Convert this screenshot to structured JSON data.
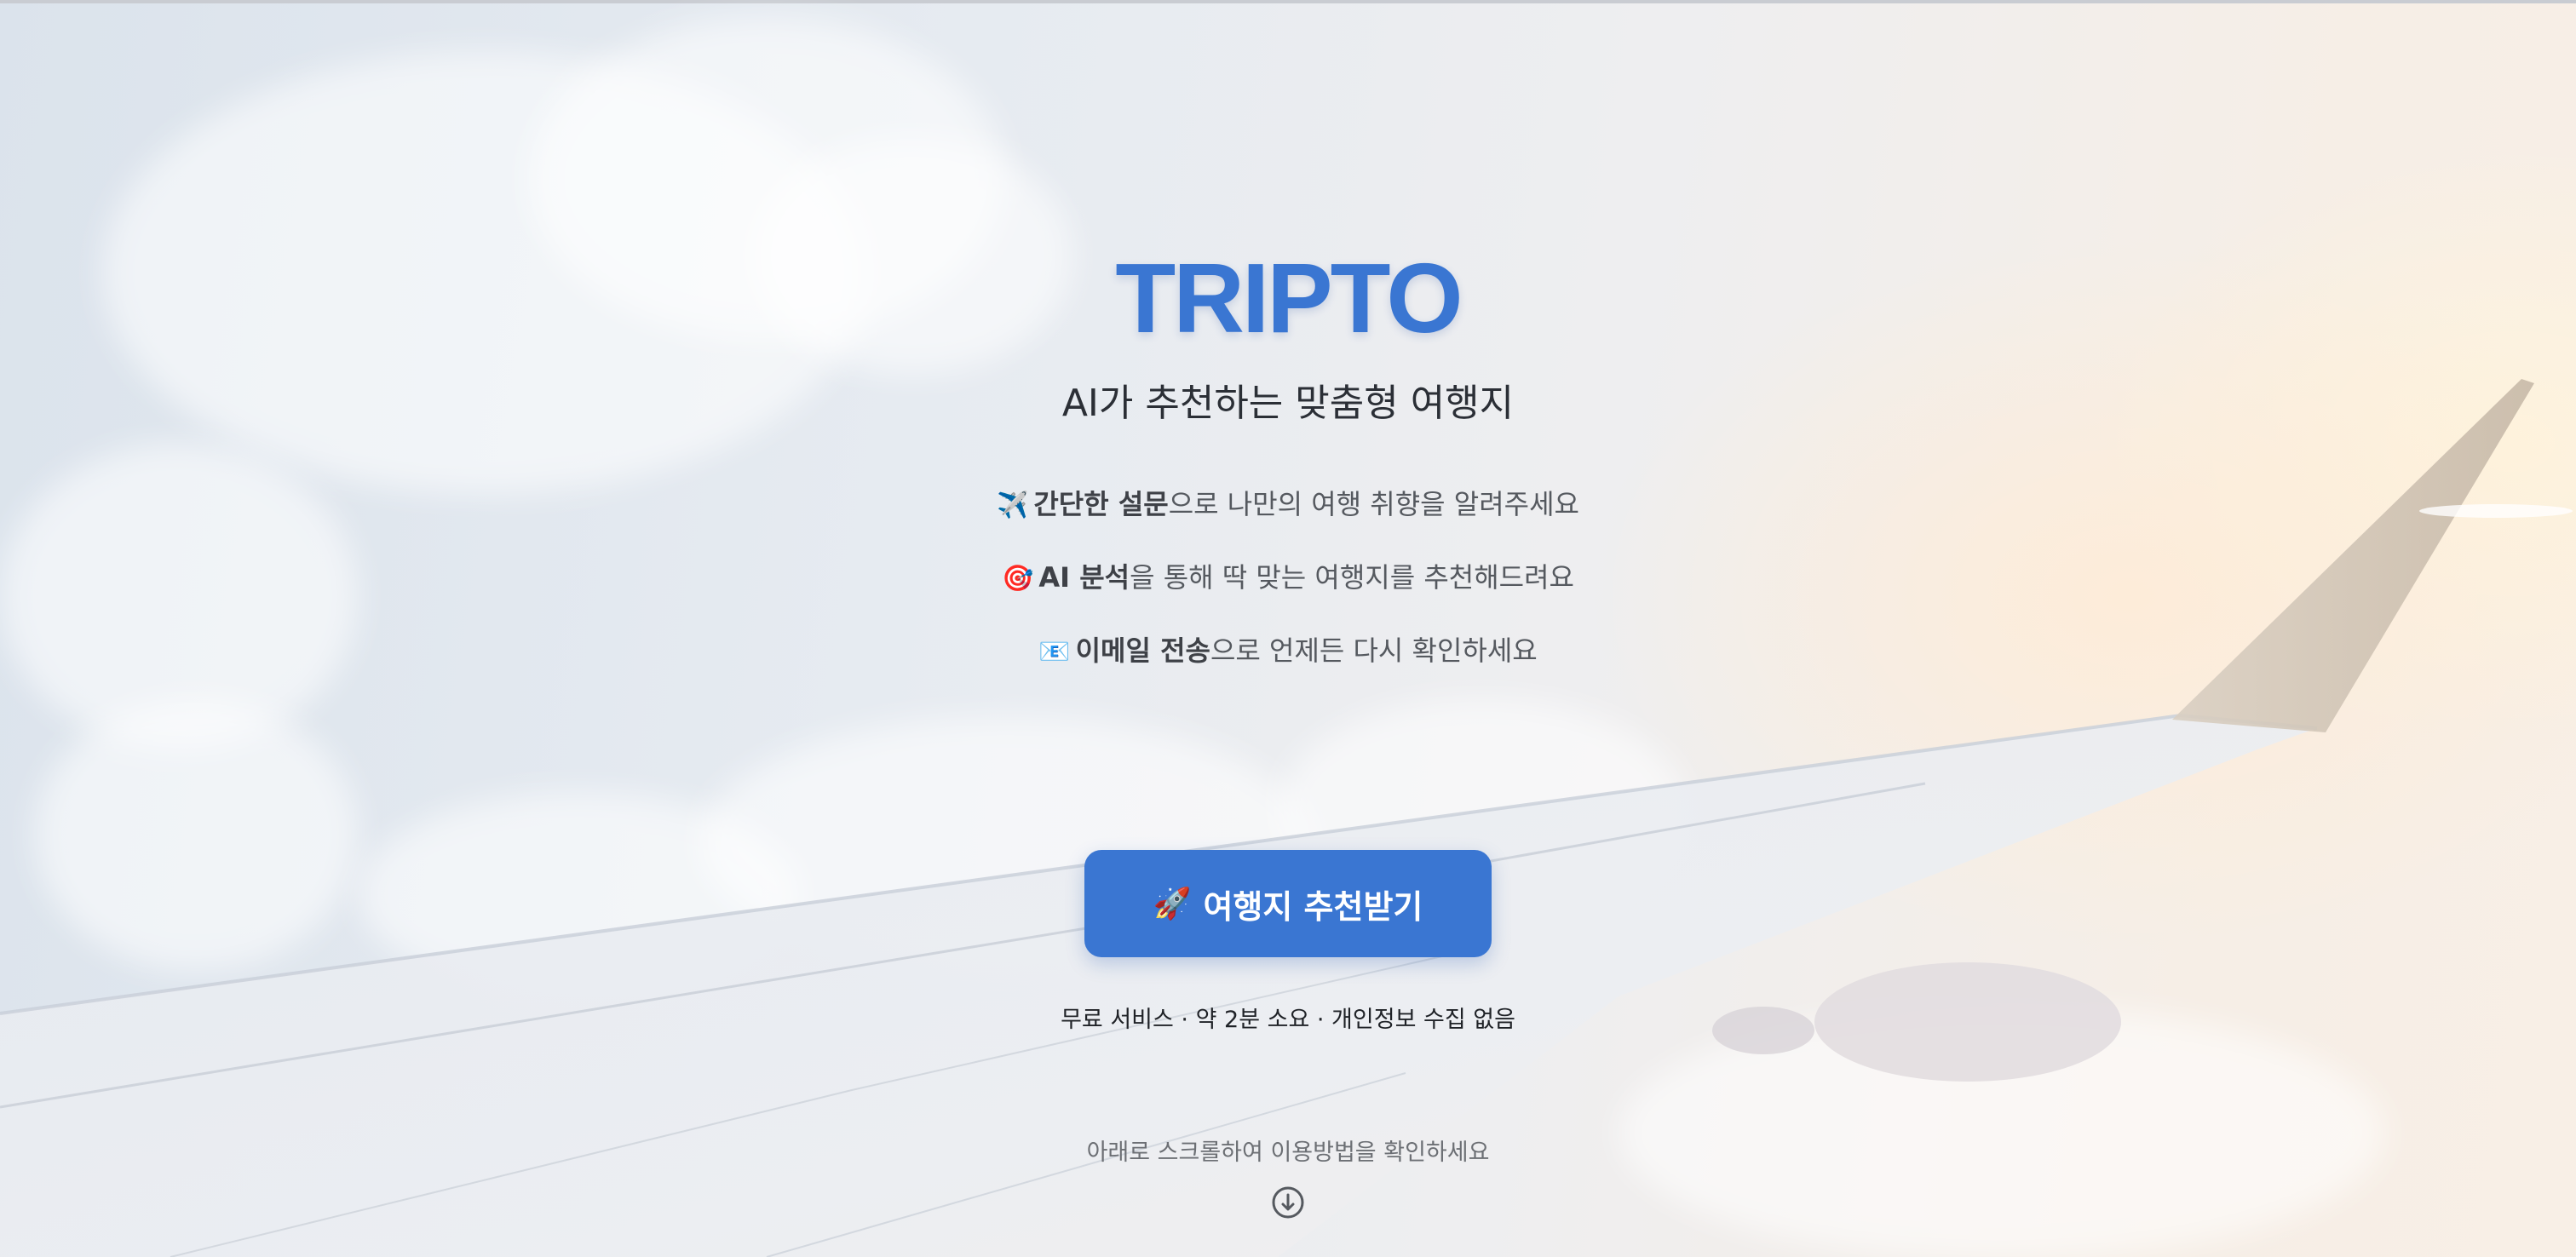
{
  "brand": {
    "logo": "TRIPTO",
    "color": "#3a76d2"
  },
  "hero": {
    "subtitle": "AI가 추천하는 맞춤형 여행지",
    "features": [
      {
        "icon": "airplane-icon",
        "emoji": "✈️",
        "bold": "간단한 설문",
        "rest": "으로 나만의 여행 취향을 알려주세요"
      },
      {
        "icon": "target-icon",
        "emoji": "🎯",
        "bold": "AI 분석",
        "rest": "을 통해 딱 맞는 여행지를 추천해드려요"
      },
      {
        "icon": "email-icon",
        "emoji": "📧",
        "bold": "이메일 전송",
        "rest": "으로 언제든 다시 확인하세요"
      }
    ],
    "cta": {
      "icon": "rocket-icon",
      "emoji": "🚀",
      "label": "여행지 추천받기"
    },
    "note": "무료 서비스 · 약 2분 소요 · 개인정보 수집 없음",
    "scroll_hint": "아래로 스크롤하여 이용방법을 확인하세요",
    "scroll_icon": "arrow-down-circle-icon"
  }
}
